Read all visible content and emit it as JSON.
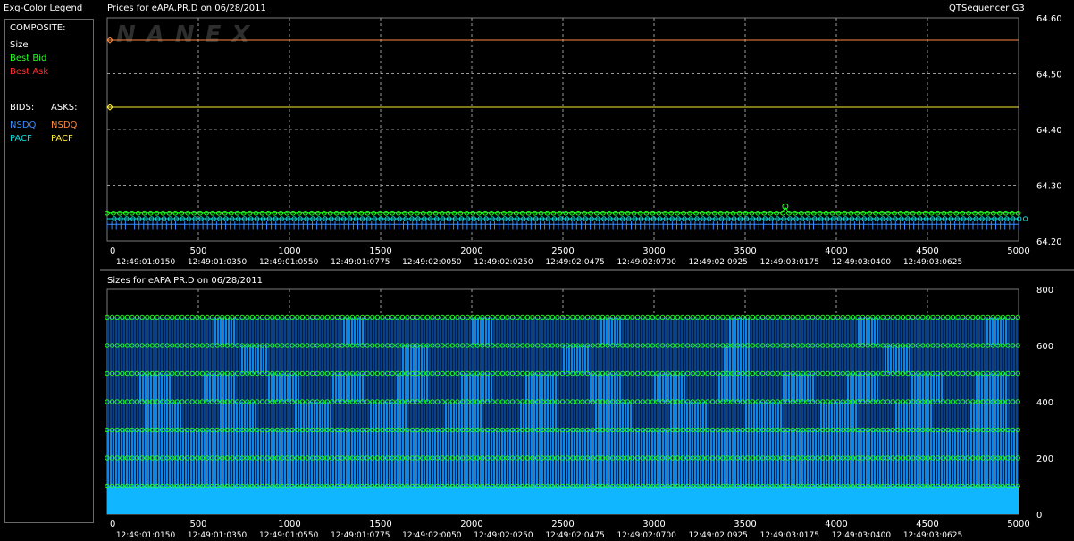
{
  "window": {
    "legend_title": "Exg-Color Legend",
    "prices_title": "Prices for  eAPA.PR.D  on  06/28/2011",
    "sizes_title": "Sizes for  eAPA.PR.D  on  06/28/2011",
    "app_name": "QTSequencer G3",
    "watermark": "NANEX"
  },
  "legend": {
    "composite_label": "COMPOSITE:",
    "size_label": "Size",
    "best_bid_label": "Best Bid",
    "best_ask_label": "Best Ask",
    "bids_label": "BIDS:",
    "asks_label": "ASKS:",
    "bid_nsdq": "NSDQ",
    "ask_nsdq": "NSDQ",
    "bid_pacf": "PACF",
    "ask_pacf": "PACF",
    "colors": {
      "size": "#ffffff",
      "best_bid": "#22ff22",
      "best_ask": "#ff3030",
      "nsdq_bid": "#3a8dff",
      "nsdq_ask": "#ff8a40",
      "pacf_bid": "#00e0e0",
      "pacf_ask": "#ffee33"
    }
  },
  "x_ticks": [
    "0",
    "500",
    "1000",
    "1500",
    "2000",
    "2500",
    "3000",
    "3500",
    "4000",
    "4500",
    "5000"
  ],
  "time_labels": [
    "12:49:01:0150",
    "12:49:01:0350",
    "12:49:01:0550",
    "12:49:01:0775",
    "12:49:02:0050",
    "12:49:02:0250",
    "12:49:02:0475",
    "12:49:02:0700",
    "12:49:02:0925",
    "12:49:03:0175",
    "12:49:03:0400",
    "12:49:03:0625"
  ],
  "chart_data": [
    {
      "type": "line",
      "title": "Prices for  eAPA.PR.D  on  06/28/2011",
      "xlim": [
        0,
        5000
      ],
      "ylim": [
        64.2,
        64.6
      ],
      "y_ticks": [
        "64.60",
        "64.50",
        "64.40",
        "64.30",
        "64.20"
      ],
      "grid": true,
      "series": [
        {
          "name": "NSDQ Ask",
          "color": "#ff8a40",
          "values": [
            [
              0,
              64.56
            ],
            [
              5000,
              64.56
            ]
          ]
        },
        {
          "name": "PACF Ask",
          "color": "#ffee33",
          "values": [
            [
              0,
              64.44
            ],
            [
              5000,
              64.44
            ]
          ]
        },
        {
          "name": "Best Bid",
          "color": "#22ff22",
          "values": [
            [
              0,
              64.25
            ],
            [
              3700,
              64.25
            ],
            [
              3720,
              64.26
            ],
            [
              3740,
              64.25
            ],
            [
              5000,
              64.25
            ]
          ]
        },
        {
          "name": "PACF Bid",
          "color": "#00e0e0",
          "values": [
            [
              0,
              64.24
            ],
            [
              5000,
              64.24
            ]
          ]
        },
        {
          "name": "NSDQ Bid",
          "color": "#3a8dff",
          "values": [
            [
              0,
              64.23
            ],
            [
              5000,
              64.23
            ]
          ]
        }
      ]
    },
    {
      "type": "bar",
      "title": "Sizes for  eAPA.PR.D  on  06/28/2011",
      "xlim": [
        0,
        5000
      ],
      "ylim": [
        0,
        800
      ],
      "y_ticks": [
        "800",
        "600",
        "400",
        "200",
        "0"
      ],
      "grid": true,
      "size_levels": [
        100,
        200,
        300,
        400,
        500,
        600,
        700
      ],
      "description_levels": "Bid sizes oscillate between 100 and 700 shares across the sequence"
    }
  ]
}
